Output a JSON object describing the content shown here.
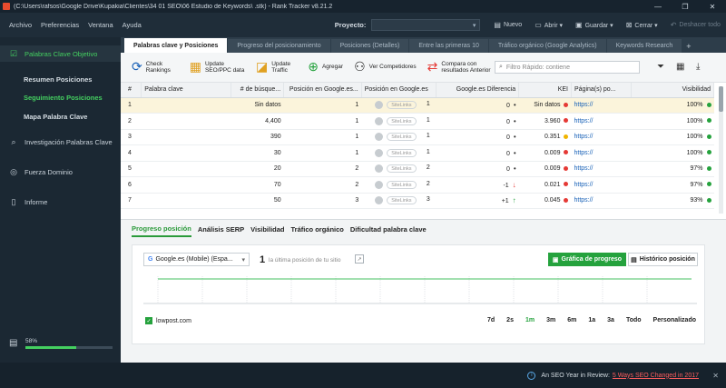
{
  "window": {
    "title": "(C:\\Users\\rafsos\\Google Drive\\Kupakia\\Clientes\\34                01 SEO\\06 Estudio de Keywords\\                       .stk) - Rank Tracker v8.21.2",
    "controls": [
      "—",
      "❐",
      "✕"
    ]
  },
  "menu": [
    "Archivo",
    "Preferencias",
    "Ventana",
    "Ayuda"
  ],
  "project": {
    "label": "Proyecto:",
    "value": "▾"
  },
  "toolbar_top": [
    {
      "icon": "new-icon",
      "label": "Nuevo"
    },
    {
      "icon": "folder-icon",
      "label": "Abrir ▾"
    },
    {
      "icon": "save-icon",
      "label": "Guardar ▾"
    },
    {
      "icon": "close-icon",
      "label": "Cerrar ▾"
    },
    {
      "icon": "undo-icon",
      "label": "Deshacer todo"
    }
  ],
  "sidebar": {
    "items": [
      {
        "label": "Palabras Clave Objetivo",
        "icon": "target-icon"
      },
      {
        "label": "Investigación Palabras Clave",
        "icon": "search-icon"
      },
      {
        "label": "Fuerza Dominio",
        "icon": "domain-icon"
      },
      {
        "label": "Informe",
        "icon": "report-icon"
      }
    ],
    "sub_items": [
      "Resumen Posiciones",
      "Seguimiento Posiciones",
      "Mapa Palabra Clave"
    ],
    "progress_label": "58%",
    "progress_value": 0.58
  },
  "tabs": [
    "Palabras clave y Posiciones",
    "Progreso del posicionamiento",
    "Posiciones (Detalles)",
    "Entre las primeras 10",
    "Tráfico orgánico (Google Analytics)",
    "Keywords Research"
  ],
  "toolbar": {
    "check": "Check Rankings",
    "update_seo": "Update SEO/PPC data",
    "update_traffic": "Update Traffic",
    "add": "Agregar",
    "competitors": "Ver Competidores",
    "compare": "Compara con resultados Anterior",
    "filter_placeholder": "Filtro Rápido: contiene"
  },
  "table": {
    "headers": [
      "#",
      "Palabra clave",
      "# de búsque...",
      "Posición en Google.es...",
      "Posición en Google.es",
      "Google.es Diferencia",
      "KEI",
      "Página(s) po...",
      "Visibilidad"
    ],
    "sitelinks": "SiteLinks",
    "rows": [
      {
        "n": "1",
        "kw": "",
        "searches": "Sin datos",
        "pos": "1",
        "pos2": "1",
        "diff": "0",
        "diff_sym": "•",
        "kei": "Sin datos",
        "kei_color": "#e53935",
        "page": "https://",
        "vis": "100%"
      },
      {
        "n": "2",
        "kw": "",
        "searches": "4,400",
        "pos": "1",
        "pos2": "1",
        "diff": "0",
        "diff_sym": "•",
        "kei": "3.960",
        "kei_color": "#e53935",
        "page": "https://",
        "vis": "100%"
      },
      {
        "n": "3",
        "kw": "",
        "searches": "390",
        "pos": "1",
        "pos2": "1",
        "diff": "0",
        "diff_sym": "•",
        "kei": "0.351",
        "kei_color": "#f0b400",
        "page": "https://",
        "vis": "100%"
      },
      {
        "n": "4",
        "kw": "",
        "searches": "30",
        "pos": "1",
        "pos2": "1",
        "diff": "0",
        "diff_sym": "•",
        "kei": "0.009",
        "kei_color": "#e53935",
        "page": "https://",
        "vis": "100%"
      },
      {
        "n": "5",
        "kw": "",
        "searches": "20",
        "pos": "2",
        "pos2": "2",
        "diff": "0",
        "diff_sym": "•",
        "kei": "0.009",
        "kei_color": "#e53935",
        "page": "https://",
        "vis": "97%"
      },
      {
        "n": "6",
        "kw": "",
        "searches": "70",
        "pos": "2",
        "pos2": "2",
        "diff": "-1",
        "diff_sym": "↓",
        "kei": "0.021",
        "kei_color": "#e53935",
        "page": "https://",
        "vis": "97%"
      },
      {
        "n": "7",
        "kw": "",
        "searches": "50",
        "pos": "3",
        "pos2": "3",
        "diff": "+1",
        "diff_sym": "↑",
        "kei": "0.045",
        "kei_color": "#e53935",
        "page": "https://",
        "vis": "93%"
      }
    ]
  },
  "bottom": {
    "tabs": [
      "Progreso posición",
      "Análisis SERP",
      "Visibilidad",
      "Tráfico orgánico",
      "Dificultad palabra clave"
    ],
    "engine": "Google.es (Mobile) (Espa...",
    "last_pos": "1",
    "last_pos_text": "la última posición de tu sitio",
    "btn_progress": "Gráfica de progreso",
    "btn_history": "Histórico posición",
    "legend": "lowpost.com",
    "ranges": [
      "7d",
      "2s",
      "1m",
      "3m",
      "6m",
      "1a",
      "3a",
      "Todo",
      "Personalizado"
    ]
  },
  "status": {
    "text": "An SEO Year in Review:",
    "link": "5 Ways SEO Changed in 2017"
  },
  "colors": {
    "accent": "#25a23d",
    "sidebar": "#1b2833",
    "selected_row": "#fbf4db"
  }
}
